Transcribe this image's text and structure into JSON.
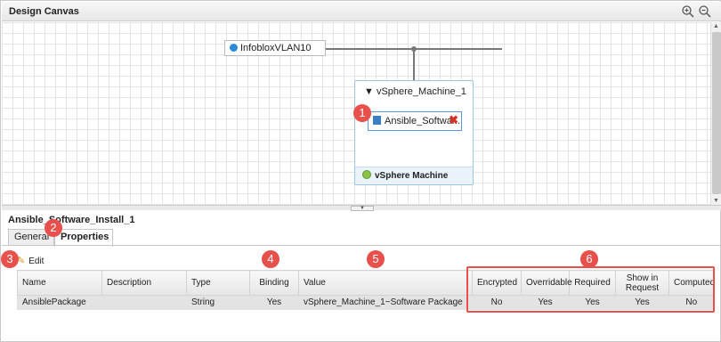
{
  "canvas": {
    "title": "Design Canvas",
    "zoom_in_icon": "zoom-in-icon",
    "zoom_out_icon": "zoom-out-icon"
  },
  "network": {
    "label": "InfobloxVLAN10",
    "icon": "globe-icon"
  },
  "machine": {
    "title": "▼ vSphere_Machine_1",
    "footer": "vSphere Machine",
    "component_label": "Ansible_Softwar...",
    "component_icon": "software-component-icon"
  },
  "badges": [
    "1",
    "2",
    "3",
    "4",
    "5",
    "6"
  ],
  "details": {
    "selected_title": "Ansible_Software_Install_1",
    "tabs": [
      "General",
      "Properties"
    ],
    "active_tab": "Properties",
    "edit_label": "Edit"
  },
  "table": {
    "headers": [
      "Name",
      "Description",
      "Type",
      "Binding",
      "Value",
      "Encrypted",
      "Overridable",
      "Required",
      "Show in Request",
      "Computed"
    ],
    "rows": [
      [
        "AnsiblePackage",
        "",
        "String",
        "Yes",
        "vSphere_Machine_1~Software Package",
        "No",
        "Yes",
        "Yes",
        "Yes",
        "No"
      ]
    ]
  },
  "colors": {
    "highlight": "#e8514b",
    "link_blue": "#2a8bd6"
  }
}
